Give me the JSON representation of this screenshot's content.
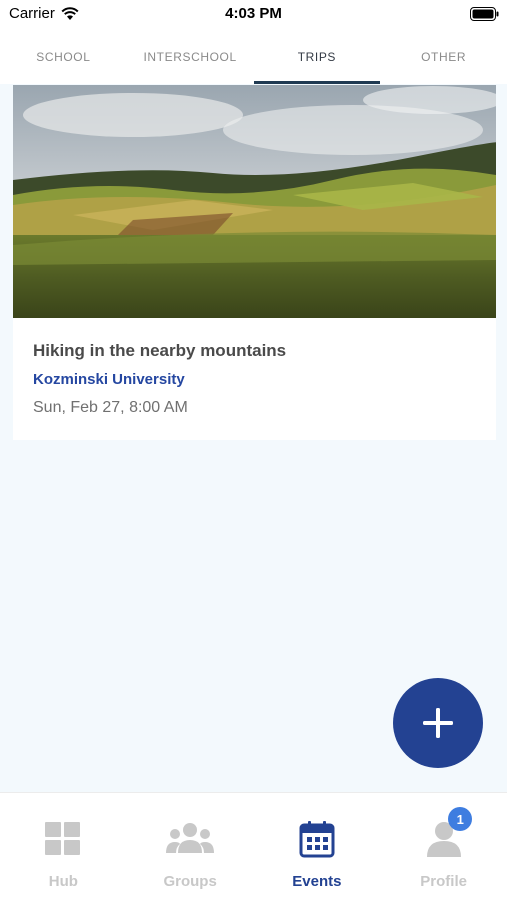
{
  "status_bar": {
    "carrier": "Carrier",
    "time": "4:03 PM",
    "icons": [
      "wifi-icon",
      "battery-icon"
    ]
  },
  "tabs": [
    {
      "label": "SCHOOL",
      "active": false
    },
    {
      "label": "INTERSCHOOL",
      "active": false
    },
    {
      "label": "TRIPS",
      "active": true
    },
    {
      "label": "OTHER",
      "active": false
    }
  ],
  "event": {
    "image": "landscape-photo",
    "title": "Hiking in the nearby mountains",
    "organizer": "Kozminski University",
    "datetime": "Sun, Feb 27, 8:00 AM"
  },
  "fab": {
    "icon": "plus-icon"
  },
  "bottom_nav": {
    "items": [
      {
        "label": "Hub",
        "icon": "grid-icon",
        "active": false
      },
      {
        "label": "Groups",
        "icon": "group-icon",
        "active": false
      },
      {
        "label": "Events",
        "icon": "calendar-icon",
        "active": true
      },
      {
        "label": "Profile",
        "icon": "person-icon",
        "active": false,
        "badge": "1"
      }
    ]
  },
  "colors": {
    "accent": "#234292",
    "organizer": "#2547a1",
    "badge": "#3e7de0",
    "background": "#f3f9fd",
    "inactive": "#c8c8c8"
  }
}
